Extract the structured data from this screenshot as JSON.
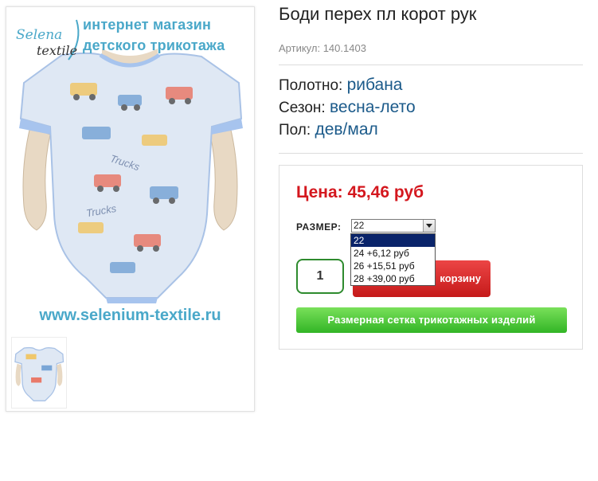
{
  "image": {
    "shop_line1": "интернет магазин",
    "shop_line2": "детского трикотажа",
    "logo_text1": "Selena",
    "logo_text2": "textile",
    "website": "www.selenium-textile.ru",
    "print_word": "Trucks"
  },
  "product": {
    "title": "Боди перех пл корот рук",
    "sku_label": "Артикул:",
    "sku": "140.1403"
  },
  "attributes": [
    {
      "label": "Полотно:",
      "value": "рибана"
    },
    {
      "label": "Сезон:",
      "value": "весна-лето"
    },
    {
      "label": "Пол:",
      "value": "дев/мал"
    }
  ],
  "purchase": {
    "price_label": "Цена:",
    "price": "45,46 руб",
    "size_label": "РАЗМЕР:",
    "size_selected": "22",
    "size_options": [
      "22",
      "24 +6,12 руб",
      "26 +15,51 руб",
      "28 +39,00 руб"
    ],
    "quantity": "1",
    "cart_label_visible": "корзину",
    "size_chart_button": "Размерная сетка трикотажных изделий"
  },
  "colors": {
    "price": "#d4171e",
    "attribute_value": "#1b5a8a",
    "cart_button": "#d92a2a",
    "size_chart_button": "#4ccb3a",
    "brand_blue": "#4aa8c9",
    "dropdown_selected": "#0a246a"
  }
}
